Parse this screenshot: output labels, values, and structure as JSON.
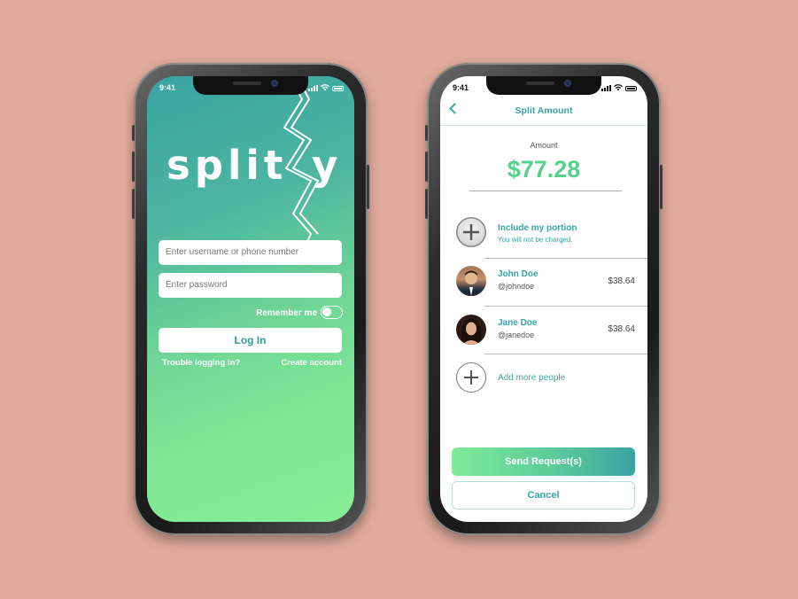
{
  "status_bar": {
    "time": "9:41"
  },
  "login_screen": {
    "logo_text": "split",
    "logo_tail": "y",
    "username_placeholder": "Enter username or phone number",
    "password_placeholder": "Enter password",
    "remember_label": "Remember me",
    "remember_on": false,
    "login_label": "Log In",
    "trouble_label": "Trouble logging in?",
    "create_label": "Create account"
  },
  "split_screen": {
    "title": "Split Amount",
    "amount_label": "Amount",
    "amount_value": "$77.28",
    "include": {
      "title": "Include my portion",
      "subtitle": "You will not be charged."
    },
    "people": [
      {
        "name": "John Doe",
        "handle": "@johndoe",
        "amount": "$38.64"
      },
      {
        "name": "Jane Doe",
        "handle": "@janedoe",
        "amount": "$38.64"
      }
    ],
    "add_more_label": "Add more people",
    "send_label": "Send Request(s)",
    "cancel_label": "Cancel"
  },
  "colors": {
    "background": "#e1ab9c",
    "teal": "#3aa3a3",
    "green": "#80ea98",
    "amount_green": "#56d08d"
  }
}
